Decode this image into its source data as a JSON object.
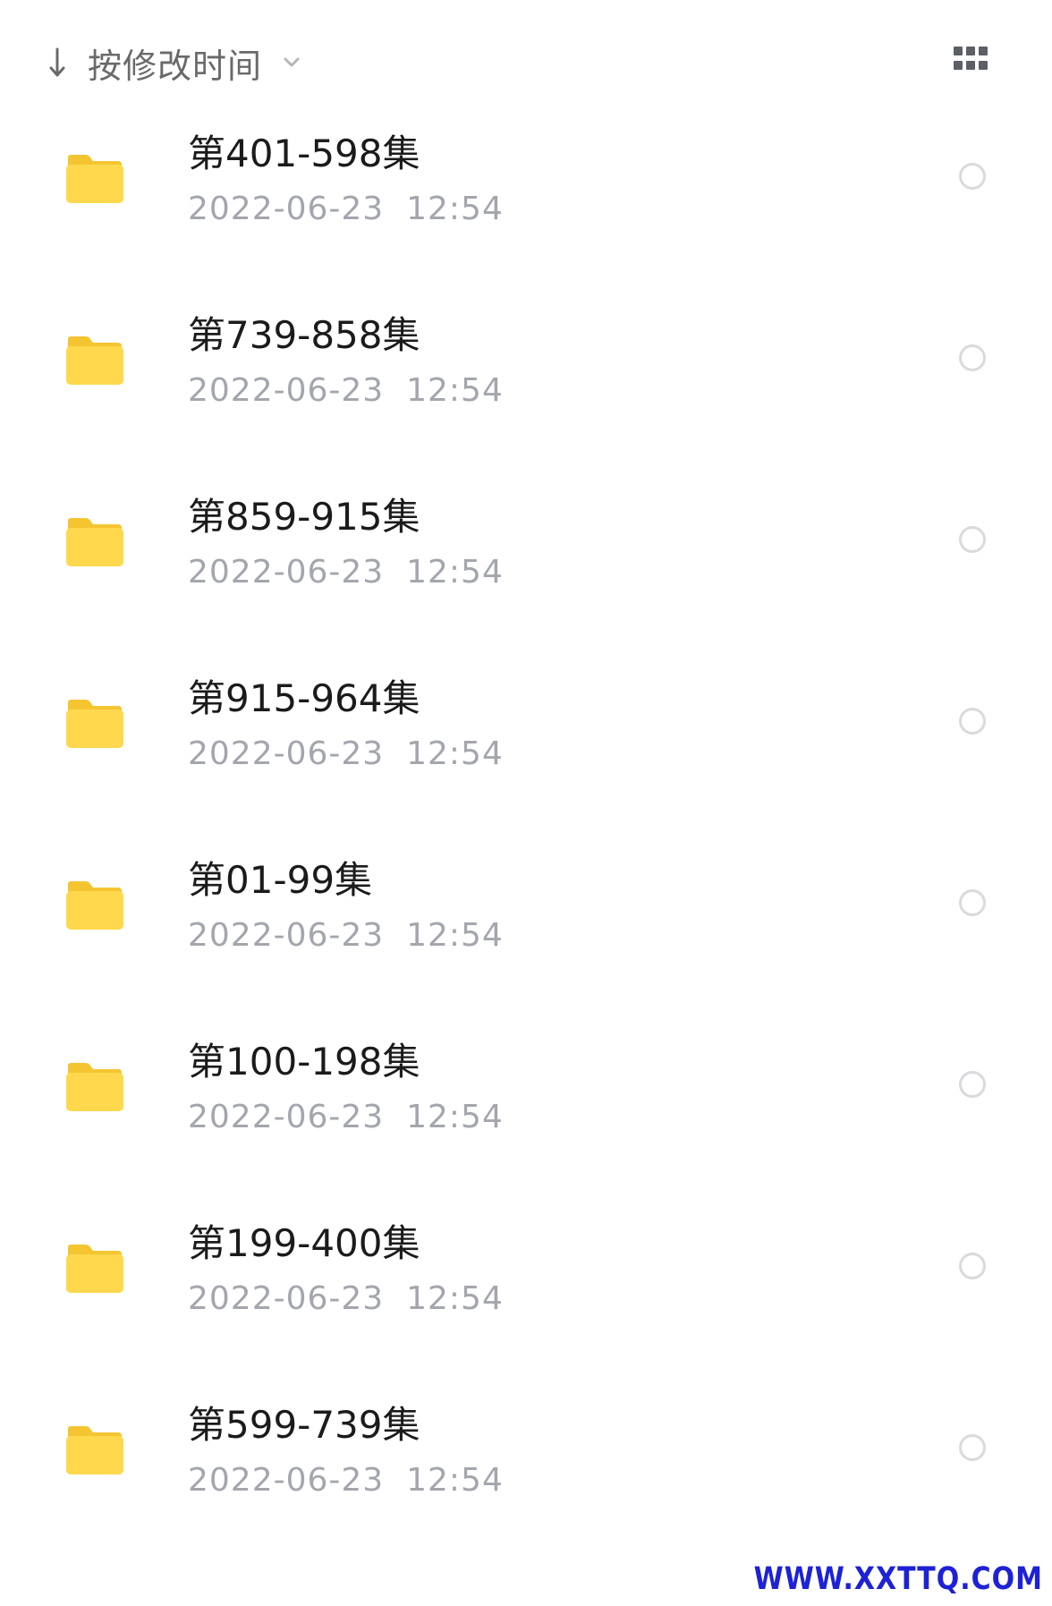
{
  "header": {
    "sort_label": "按修改时间",
    "sort_icon": "arrow-down-icon",
    "dropdown_icon": "chevron-down-icon",
    "view_toggle_icon": "grid-view-icon"
  },
  "colors": {
    "folder": "#FFD84D",
    "folder_tab": "#F5C531",
    "title_text": "#1b1b1b",
    "date_text": "#a3a6ad",
    "select_circle": "#d9dadd",
    "watermark": "#1d22d6"
  },
  "files": [
    {
      "name": "第401-598集",
      "date": "2022-06-23  12:54",
      "icon": "folder-icon"
    },
    {
      "name": "第739-858集",
      "date": "2022-06-23  12:54",
      "icon": "folder-icon"
    },
    {
      "name": "第859-915集",
      "date": "2022-06-23  12:54",
      "icon": "folder-icon"
    },
    {
      "name": "第915-964集",
      "date": "2022-06-23  12:54",
      "icon": "folder-icon"
    },
    {
      "name": "第01-99集",
      "date": "2022-06-23  12:54",
      "icon": "folder-icon"
    },
    {
      "name": "第100-198集",
      "date": "2022-06-23  12:54",
      "icon": "folder-icon"
    },
    {
      "name": "第199-400集",
      "date": "2022-06-23  12:54",
      "icon": "folder-icon"
    },
    {
      "name": "第599-739集",
      "date": "2022-06-23  12:54",
      "icon": "folder-icon"
    }
  ],
  "watermark": "WWW.XXTTQ.COM"
}
